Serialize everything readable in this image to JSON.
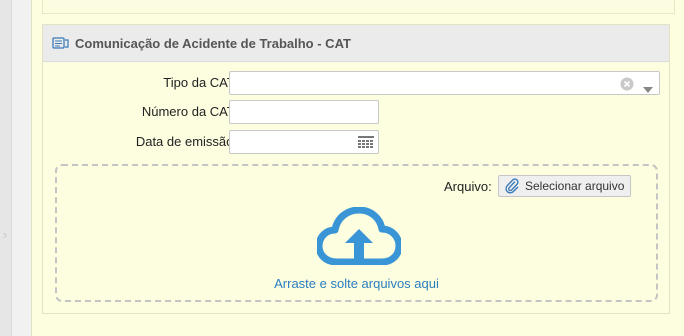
{
  "panel": {
    "title": "Comunicação de Acidente de Trabalho - CAT",
    "header_icon": "form-icon"
  },
  "form": {
    "tipo_cat": {
      "label": "Tipo da CAT:",
      "value": ""
    },
    "numero_cat": {
      "label": "Número da CAT:",
      "value": ""
    },
    "data_emissao": {
      "label": "Data de emissão:",
      "value": ""
    }
  },
  "upload": {
    "arquivo_label": "Arquivo:",
    "select_button_label": "Selecionar arquivo",
    "drop_text": "Arraste e solte arquivos aqui",
    "icon": "cloud-upload-icon"
  },
  "colors": {
    "panel_background": "#fdfde0",
    "header_background": "#ebebeb",
    "accent": "#3a95d6",
    "link": "#2a7fbf"
  }
}
